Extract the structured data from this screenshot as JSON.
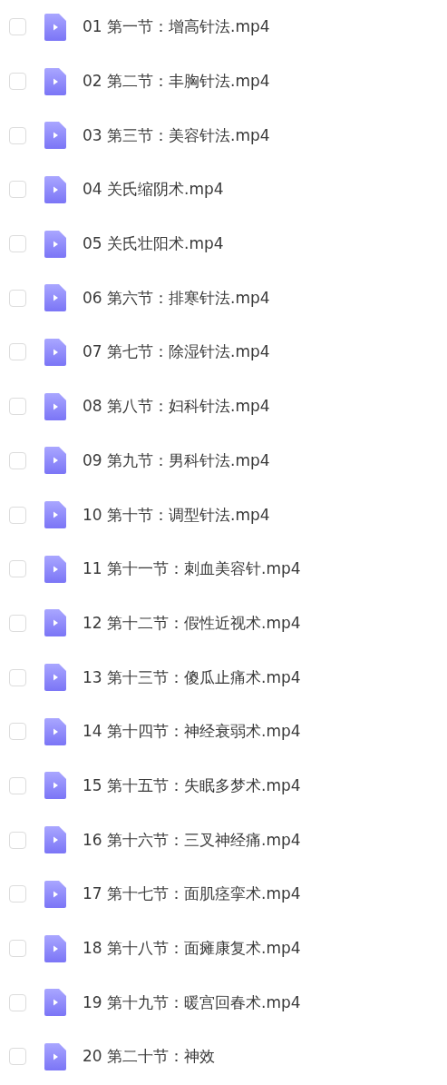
{
  "files": [
    {
      "name": "01 第一节：增高针法.mp4",
      "checked": false
    },
    {
      "name": "02 第二节：丰胸针法.mp4",
      "checked": false
    },
    {
      "name": "03 第三节：美容针法.mp4",
      "checked": false
    },
    {
      "name": "04 关氏缩阴术.mp4",
      "checked": false
    },
    {
      "name": "05 关氏壮阳术.mp4",
      "checked": false
    },
    {
      "name": "06 第六节：排寒针法.mp4",
      "checked": false
    },
    {
      "name": "07 第七节：除湿针法.mp4",
      "checked": false
    },
    {
      "name": "08 第八节：妇科针法.mp4",
      "checked": false
    },
    {
      "name": "09 第九节：男科针法.mp4",
      "checked": false
    },
    {
      "name": "10 第十节：调型针法.mp4",
      "checked": false
    },
    {
      "name": "11 第十一节：刺血美容针.mp4",
      "checked": false
    },
    {
      "name": "12 第十二节：假性近视术.mp4",
      "checked": false
    },
    {
      "name": "13 第十三节：傻瓜止痛术.mp4",
      "checked": false
    },
    {
      "name": "14 第十四节：神经衰弱术.mp4",
      "checked": false
    },
    {
      "name": "15 第十五节：失眠多梦术.mp4",
      "checked": false
    },
    {
      "name": "16 第十六节：三叉神经痛.mp4",
      "checked": false
    },
    {
      "name": "17 第十七节：面肌痉挛术.mp4",
      "checked": false
    },
    {
      "name": "18 第十八节：面瘫康复术.mp4",
      "checked": false
    },
    {
      "name": "19 第十九节：暖宫回春术.mp4",
      "checked": false
    },
    {
      "name": "20 第二十节：神效",
      "checked": false
    }
  ]
}
